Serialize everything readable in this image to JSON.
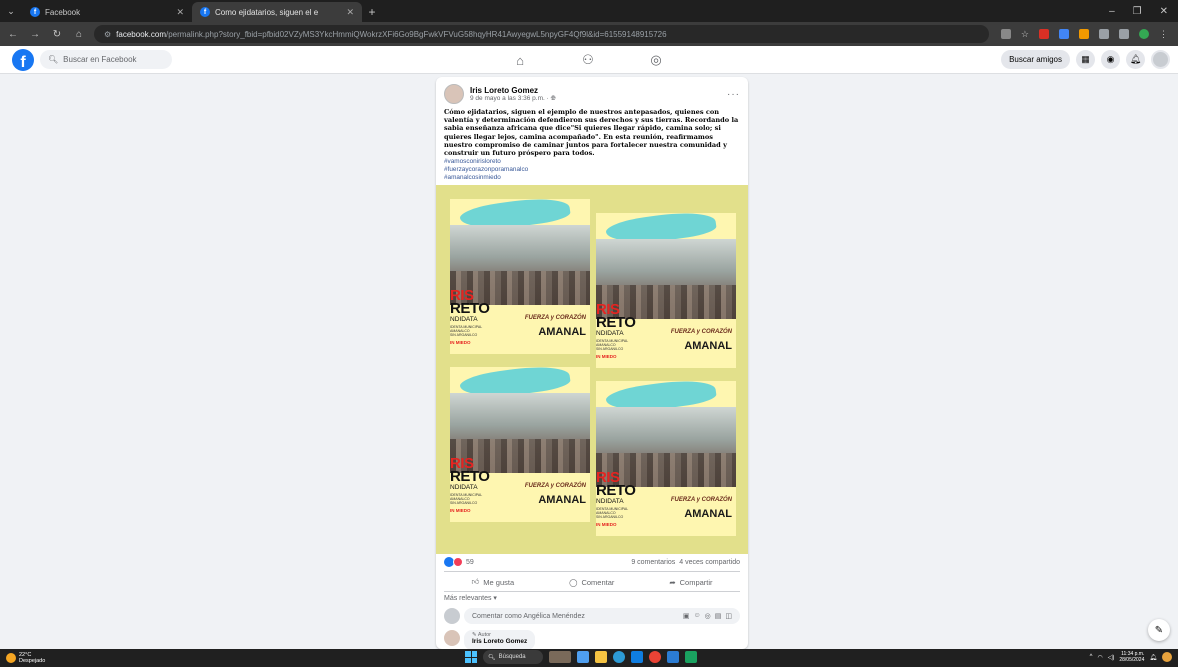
{
  "browser": {
    "tabs": [
      {
        "title": "Facebook"
      },
      {
        "title": "Como ejidatarios, siguen el e"
      }
    ],
    "new_tab": "+",
    "url_host": "facebook.com",
    "url_path": "/permalink.php?story_fbid=pfbid02VZyMS3YkcHmmiQWokrzXFi6Go9BgFwkVFVuG58hqyHR41AwyegwL5npyGF4Qf9l&id=61559148915726"
  },
  "facebook": {
    "logo": "f",
    "search_placeholder": "Buscar en Facebook",
    "find_friends": "Buscar amigos"
  },
  "post": {
    "author": "Iris Loreto Gomez",
    "timestamp": "9 de mayo a las 3:36 p.m. ·",
    "text": "Cómo ejidatarios, siguen el ejemplo de nuestros antepasados, quienes con valentía y determinación defendieron sus derechos y sus tierras. Recordando la sabia enseñanza africana que dice\"Si quieres llegar rápido, camina solo; si quieres llegar lejos, camina acompañado\". En esta reunión, reafirmamos nuestro compromiso de caminar juntos para fortalecer nuestra comunidad y construir un futuro próspero para todos.",
    "hashtags": [
      "#vamosconirisloreto",
      "#fuerzaycorazonporamanalco",
      "#amanalcosinmiedo"
    ],
    "poster": {
      "name_top": "RIS",
      "name_bottom": "RETO",
      "candidate": "NDIDATA",
      "small_lines": "IDENTA MUNICIPAL\nAMANALCO\nSIN ARGANILCO",
      "sin_miedo": "IN MIEDO",
      "slogan": "FUERZA y CORAZÓN",
      "town": "AMANAL"
    },
    "reaction_count": "59",
    "comments_count": "9 comentarios",
    "shares_count": "4 veces compartido",
    "actions": {
      "like": "Me gusta",
      "comment": "Comentar",
      "share": "Compartir"
    },
    "sort_label": "Más relevantes",
    "comment_placeholder": "Comentar como Angélica Menéndez",
    "first_comment": {
      "tag": "Autor",
      "author": "Iris Loreto Gomez"
    }
  },
  "taskbar": {
    "weather_temp": "22°C",
    "weather_desc": "Despejado",
    "search_label": "Búsqueda",
    "time": "11:34 p.m.",
    "date": "28/05/2024"
  }
}
